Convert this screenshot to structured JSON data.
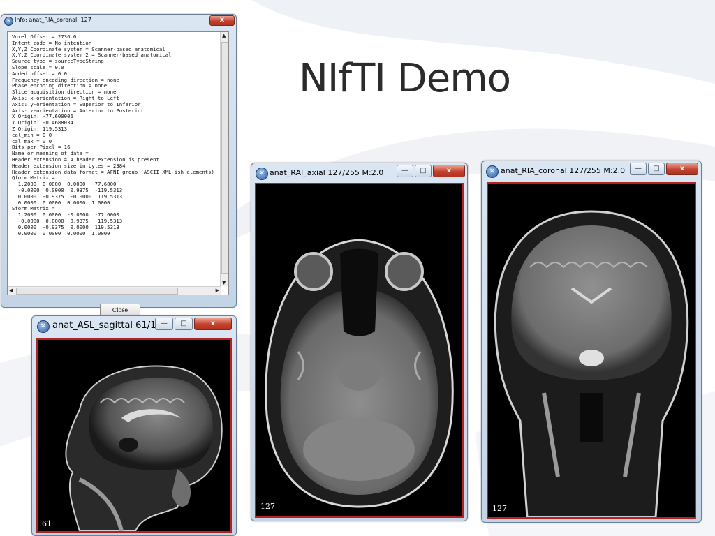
{
  "slide": {
    "title": "NIfTI Demo"
  },
  "info_window": {
    "title": "Info: anat_RIA_coronal: 127",
    "close_label": "Close",
    "lines": [
      "Voxel Offset = 2736.0",
      "Intent code = No intention",
      "X,Y,Z Coordinate system = Scanner-based anatomical",
      "X,Y,Z Coordinate system 2 = Scanner-based anatomical",
      "Source type = sourceTypeString",
      "Slope scale = 0.0",
      "Added offset = 0.0",
      "Frequency encoding direction = none",
      "Phase encoding direction = none",
      "Slice acquisition direction = none",
      "Axis: x-orientation = Right to Left",
      "Axis: y-orientation = Superior to Inferior",
      "Axis: z-orientation = Anterior to Posterior",
      "X Origin: -77.600006",
      "Y Origin: -0.4688034",
      "Z Origin: 119.5313",
      "cal_min = 0.0",
      "cal_max = 0.0",
      "Bits per Pixel = 16",
      "Name or meaning of data =",
      "Header extension = A header extension is present",
      "Header extension size in bytes = 2384",
      "Header extension data format = AFNI group (ASCII XML-ish elements)",
      "Qform Matrix =",
      "  1.2000  0.0000  0.0000  -77.6000",
      "  -0.0000  0.0000  0.9375  -119.5313",
      "  0.0000  -0.9375  -0.0000  119.5313",
      "  0.0000  0.0000  0.0000  1.0000",
      "Sform Matrix =",
      "  1.2000  0.0000  -0.0000  -77.6000",
      "  -0.0000  0.0000  0.9375  -119.5313",
      "  0.0000  -0.9375  0.0000  119.5313",
      "  0.0000  0.0000  0.0000  1.0000"
    ]
  },
  "sagittal_window": {
    "title": "anat_ASL_sagittal  61/1...",
    "slice": "61"
  },
  "axial_window": {
    "title": "anat_RAI_axial  127/255 M:2.0",
    "slice": "127"
  },
  "coronal_window": {
    "title": "anat_RIA_coronal  127/255 M:2.0",
    "slice": "127"
  },
  "controls": {
    "minimize": "—",
    "maximize": "□",
    "close": "x"
  },
  "colors": {
    "frame_border": "#b22222",
    "accent": "#2f5d9e"
  }
}
